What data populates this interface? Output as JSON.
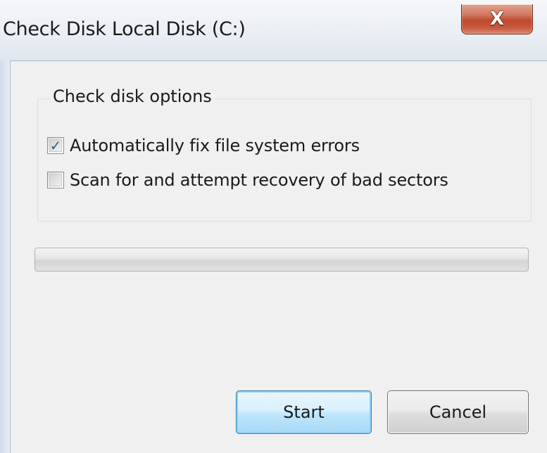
{
  "window": {
    "title": "Check Disk Local Disk (C:)",
    "close_glyph": "X"
  },
  "options_group": {
    "legend": "Check disk options",
    "options": [
      {
        "label": "Automatically fix file system errors",
        "checked": true,
        "check_glyph": "✓"
      },
      {
        "label": "Scan for and attempt recovery of bad sectors",
        "checked": false,
        "check_glyph": ""
      }
    ]
  },
  "progress": {
    "value": 0
  },
  "buttons": {
    "start_label": "Start",
    "cancel_label": "Cancel"
  },
  "icons": {
    "close": "close-icon",
    "check": "checkmark-icon"
  },
  "colors": {
    "close_button": "#c85a3c",
    "default_button_border": "#3c7fb1",
    "checkmark": "#3a5a8c"
  }
}
